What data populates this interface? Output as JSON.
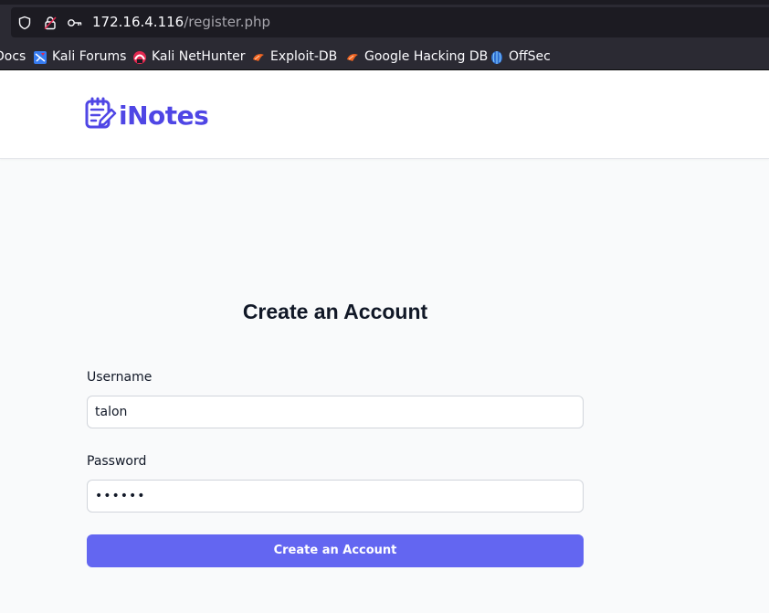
{
  "browser": {
    "url_host": "172.16.4.116",
    "url_path": "/register.php"
  },
  "bookmarks": [
    {
      "label": "Docs",
      "icon": "docs-icon"
    },
    {
      "label": "Kali Forums",
      "icon": "kali-forums-icon"
    },
    {
      "label": "Kali NetHunter",
      "icon": "kali-nethunter-icon"
    },
    {
      "label": "Exploit-DB",
      "icon": "exploit-db-icon"
    },
    {
      "label": "Google Hacking DB",
      "icon": "google-hacking-db-icon"
    },
    {
      "label": "OffSec",
      "icon": "offsec-icon"
    }
  ],
  "header": {
    "logo_text": "iNotes"
  },
  "form": {
    "title": "Create an Account",
    "username_label": "Username",
    "username_value": "talon",
    "password_label": "Password",
    "password_value": "••••••",
    "submit_label": "Create an Account"
  },
  "colors": {
    "accent": "#6366f1",
    "logo": "#4f46e5"
  }
}
